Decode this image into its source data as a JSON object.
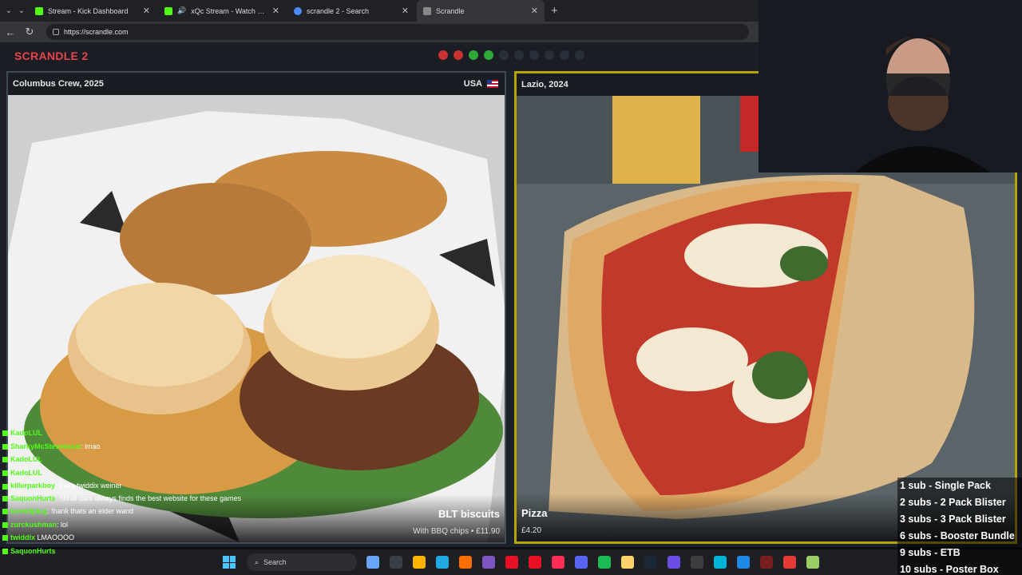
{
  "browser": {
    "tabs": [
      {
        "label": "Stream - Kick Dashboard",
        "favicon_color": "#53fc18"
      },
      {
        "label": "xQc Stream - Watch Live on K",
        "favicon_color": "#53fc18",
        "audio": "🔊"
      },
      {
        "label": "scrandle 2 - Search",
        "favicon_color": "#4c8bf5"
      },
      {
        "label": "Scrandle",
        "favicon_color": "#888888"
      }
    ],
    "new_tab_symbol": "+",
    "url": "https://scrandle.com"
  },
  "scrandle": {
    "logo": "SCRANDLE 2",
    "progress_dots": [
      "#c83232",
      "#c83232",
      "#2faa3a",
      "#2faa3a",
      "#2a303a",
      "#2a303a",
      "#2a303a",
      "#2a303a",
      "#2a303a",
      "#2a303a"
    ],
    "left_card": {
      "location": "Columbus Crew, 2025",
      "country": "USA",
      "food_name": "BLT biscuits",
      "food_sub": "With BBQ chips • £11.90"
    },
    "right_card": {
      "location": "Lazio, 2024",
      "food_name": "Pizza",
      "food_sub": "£4.20"
    }
  },
  "chat": {
    "lines": [
      {
        "user": "KadoLUL",
        "msg": ""
      },
      {
        "user": "SharkyMcStevenson",
        "msg": ": lmao"
      },
      {
        "user": "KadoLUL",
        "msg": ""
      },
      {
        "user": "KadoLUL",
        "msg": ""
      },
      {
        "user": "killerparkboy",
        "msg": ": thats twiddix weiner"
      },
      {
        "user": "SaquonHurts",
        "msg": ": !thrall dani always finds the best website for these games"
      },
      {
        "user": "kermitplug",
        "msg": ": !hank thats an elder wand"
      },
      {
        "user": "zurckushman",
        "msg": ": lol"
      },
      {
        "user": "twiddix",
        "msg": " LMAOOOO"
      },
      {
        "user": "SaquonHurts",
        "msg": ""
      }
    ]
  },
  "sub_goals": [
    "1 sub - Single Pack",
    "2 subs - 2 Pack Blister",
    "3 subs - 3 Pack Blister",
    "6 subs - Booster Bundle",
    "9 subs - ETB",
    "10 subs - Poster Box"
  ],
  "taskbar": {
    "search_placeholder": "Search",
    "app_colors": [
      "#6aa6ff",
      "#3a3d44",
      "#ffb300",
      "#1fa9e1",
      "#ff6f00",
      "#7e57c2",
      "#e81123",
      "#e81123",
      "#ff2d55",
      "#5865f2",
      "#1db954",
      "#ffd36a",
      "#1b2838",
      "#6b4de6",
      "#3c3c3c",
      "#00b4d8",
      "#1e88e5",
      "#7a1f1f",
      "#e53935",
      "#9ccc65"
    ]
  }
}
